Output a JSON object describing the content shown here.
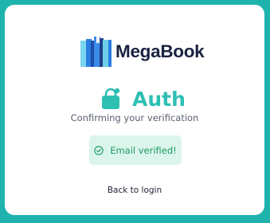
{
  "brand": {
    "name": "MegaBook",
    "logo_icon": "books-logo-icon",
    "text_color": "#1a2240"
  },
  "auth": {
    "title": "Auth",
    "icon": "shopping-bag-icon",
    "accent": "#2ebfb3",
    "subtitle": "Confirming your verification"
  },
  "status": {
    "message": "Email verified!",
    "icon": "check-circle-icon",
    "color": "#1a9a62",
    "background": "#dcf5ec"
  },
  "links": {
    "back_label": "Back to login"
  },
  "page": {
    "background": "#1fb3ad"
  }
}
